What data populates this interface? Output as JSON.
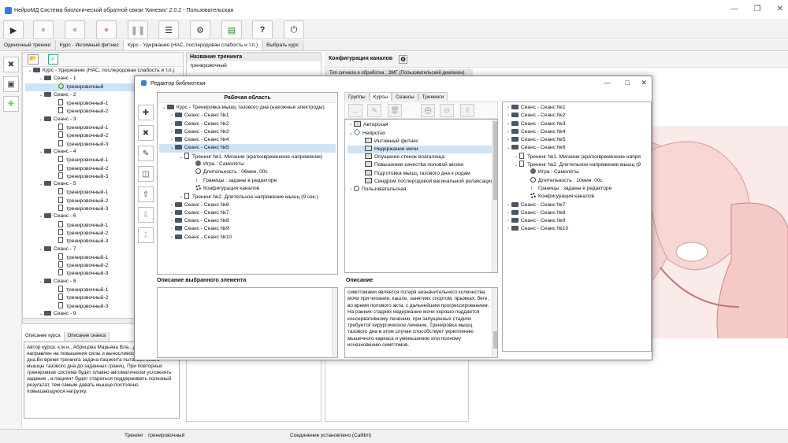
{
  "window": {
    "title": "НейроМД Система биологической обратной связи 'Кинезис' 2.0.2 - Пользовательская"
  },
  "toolbar": {
    "icons": [
      "play-icon",
      "record-disabled-icon",
      "stop-disabled-icon",
      "record-icon",
      "pause-icon",
      "database-icon",
      "settings-icon",
      "chart-icon",
      "help-icon",
      "power-icon"
    ]
  },
  "tabs": [
    {
      "label": "Одиночный тренинг"
    },
    {
      "label": "Курс - Интимный фитнес"
    },
    {
      "label": "Курс - Удержание (НАС, послеродовая слабость и т.п.)"
    },
    {
      "label": "Выбрать курс"
    }
  ],
  "course_tree": {
    "root": "Курс - Удержание (НАС, послеродовая слабость и т.п.)",
    "sessions": [
      {
        "label": "Сеанс - 1",
        "items": [
          "тренировочный"
        ]
      },
      {
        "label": "Сеанс - 2",
        "items": [
          "тренировочный-1",
          "тренировочный-2"
        ]
      },
      {
        "label": "Сеанс - 3",
        "items": [
          "тренировочный-1",
          "тренировочный-2",
          "тренировочный-3"
        ]
      },
      {
        "label": "Сеанс - 4",
        "items": [
          "тренировочный-1",
          "тренировочный-2",
          "тренировочный-3"
        ]
      },
      {
        "label": "Сеанс - 5",
        "items": [
          "тренировочный-1",
          "тренировочный-2",
          "тренировочный-3"
        ]
      },
      {
        "label": "Сеанс - 6",
        "items": [
          "тренировочный-1",
          "тренировочный-2",
          "тренировочный-3"
        ]
      },
      {
        "label": "Сеанс - 7",
        "items": [
          "тренировочный-1",
          "тренировочный-2",
          "тренировочный-3"
        ]
      },
      {
        "label": "Сеанс - 8",
        "items": [
          "тренировочный-1",
          "тренировочный-2",
          "тренировочный-3"
        ]
      },
      {
        "label": "Сеанс - 9",
        "items": []
      }
    ]
  },
  "bottom_tabs": [
    {
      "label": "Описание курса"
    },
    {
      "label": "Описание сеанса"
    }
  ],
  "course_description": "Автор курса: к.м.н., Абрицова Марьяна Вла.. Данный курс направлен на повышения силы и выносливости мышц тазового дна.Во время тренинга задача пациента пытаться сжать мышцы тазового дна до заданных границ. При повторных тренировках система будет плавно автоматически усложнять задание , а пациент будет стараться поддерживать полезный результат, тем самым давать мышце постоянно повышающуюся нагрузку.",
  "mid_panel": {
    "title": "Название тренинга",
    "value": "тренировочный"
  },
  "config": {
    "title": "Конфигурация каналов",
    "signal_type": "Тип сигнала и обработка : ЭМГ (Пользовательский диапазон)"
  },
  "statusbar": {
    "training": "Тренинг : тренировочный",
    "connection": "Соединение установлено (Callibri)"
  },
  "dialog": {
    "title": "Редактор библиотеки",
    "workspace_header": "Рабочая область",
    "workspace_tree": {
      "root": "Курс - Тренировка мышц тазового дна (накожные электроды)",
      "sessions_before": [
        "Сеанс - Сеанс №1",
        "Сеанс - Сеанс №2",
        "Сеанс - Сеанс №3",
        "Сеанс - Сеанс №4"
      ],
      "selected_session": "Сеанс - Сеанс №5",
      "training1": "Тренинг №1. Мигание (кратковременное напряжение)",
      "training1_props": [
        "Игра : Самолёты",
        "Длительность : 06мин. 00с",
        "Границы : заданы в редакторе",
        "Конфигурация каналов"
      ],
      "training2": "Тренинг №2. Длительное напряжение мышц (9 сек.)",
      "sessions_after": [
        "Сеанс - Сеанс №6",
        "Сеанс - Сеанс №7",
        "Сеанс - Сеанс №8",
        "Сеанс - Сеанс №9",
        "Сеанс - Сеанс №10"
      ]
    },
    "selected_desc_label": "Описание выбранного элемента",
    "lib_tabs": [
      {
        "label": "Группы"
      },
      {
        "label": "Курсы"
      },
      {
        "label": "Сеансы"
      },
      {
        "label": "Тренинги"
      }
    ],
    "lib_tree": {
      "author": "Авторская",
      "neurotech": "Нейротех",
      "courses": [
        "Интимный фитнес",
        "Недержание мочи",
        "Опущение стенок влагалища",
        "Повышение качества половой жизни",
        "Подготовка мышц тазового дна к родам",
        "Синдром послеродовой вагинальной релаксации"
      ],
      "user": "Пользовательская"
    },
    "description_label": "Описание",
    "description_text": "симптомами является потеря незначительного количества мочи при чихании, кашле, занятиях спортом, прыжках, беге, во время полового акта, с дальнейшим прогрессированием. На ранних стадиях недержание мочи хорошо поддается консервативному лечению, при запущенных стадиях требуется хирургическое лечение. Тренировка мышц тазового дна в этом случае способствует укреплению мышечного каркаса и уменьшению или полному исчезновению симптомов.",
    "right_tree": {
      "sessions_before": [
        "Сеанс - Сеанс №1",
        "Сеанс - Сеанс №2",
        "Сеанс - Сеанс №3",
        "Сеанс - Сеанс №4",
        "Сеанс - Сеанс №5"
      ],
      "expanded_session": "Сеанс - Сеанс №6",
      "training1": "Тренинг №1. Мигание (кратковременное напря",
      "training2": "Тренинг №2. Длительное напряжение мышц (9",
      "training2_props": [
        "Игра : Самолёты",
        "Длительность : 10мин. 00с",
        "Границы : заданы в редакторе",
        "Конфигурация каналов"
      ],
      "sessions_after": [
        "Сеанс - Сеанс №7",
        "Сеанс - Сеанс №8",
        "Сеанс - Сеанс №9",
        "Сеанс - Сеанс №10"
      ]
    }
  }
}
